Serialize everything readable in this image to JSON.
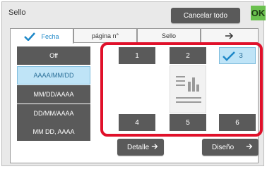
{
  "title": "Sello",
  "header": {
    "cancel_all_label": "Cancelar todo",
    "ok_label": "OK"
  },
  "tabs": [
    {
      "label": "Fecha",
      "active": true
    },
    {
      "label": "página n°",
      "active": false
    },
    {
      "label": "Sello",
      "active": false
    },
    {
      "label": "",
      "active": false
    }
  ],
  "format_options": [
    {
      "label": "Off",
      "selected": false
    },
    {
      "label": "AAAA/MM/DD",
      "selected": true
    },
    {
      "label": "MM/DD/AAAA",
      "selected": false
    },
    {
      "label": "DD/MM/AAAA",
      "selected": false
    },
    {
      "label": "MM DD, AAAA",
      "selected": false
    }
  ],
  "positions": [
    {
      "label": "1",
      "selected": false
    },
    {
      "label": "2",
      "selected": false
    },
    {
      "label": "3",
      "selected": true
    },
    {
      "label": "4",
      "selected": false
    },
    {
      "label": "5",
      "selected": false
    },
    {
      "label": "6",
      "selected": false
    }
  ],
  "footer": {
    "detail_label": "Detalle",
    "design_label": "Diseño"
  },
  "colors": {
    "accent": "#1e88c8",
    "ok": "#6ac04e",
    "highlight": "#e0102a",
    "button": "#5a5a5a",
    "selected": "#bfe4f7"
  }
}
